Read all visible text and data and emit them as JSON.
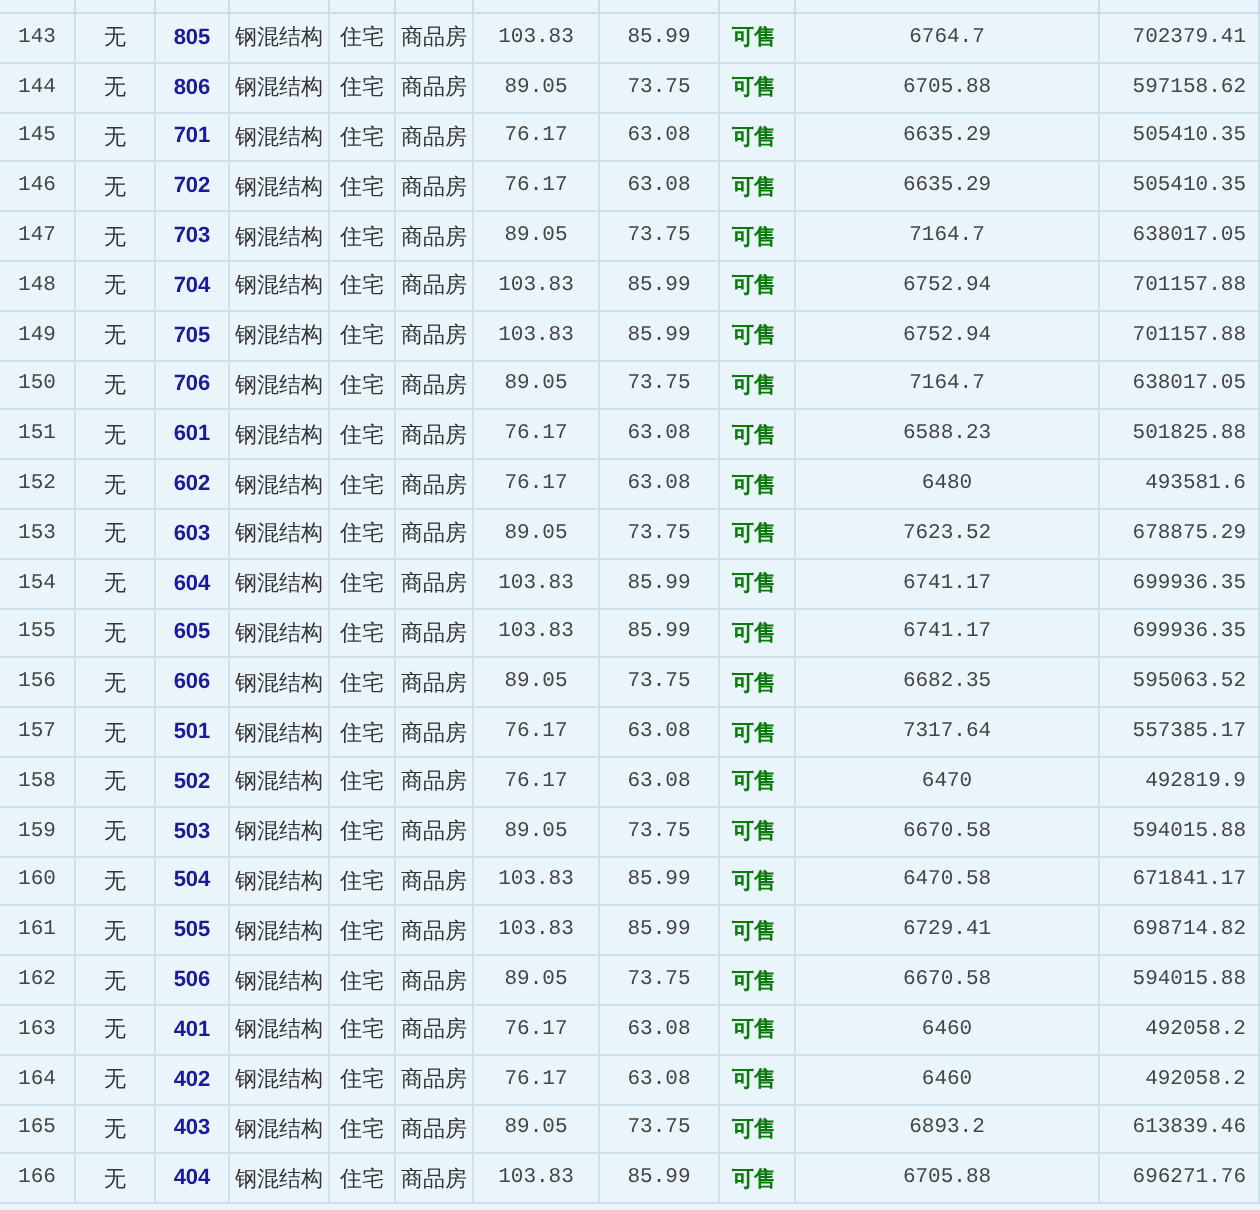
{
  "table": {
    "rows": [
      [
        "143",
        "无",
        "805",
        "钢混结构",
        "住宅",
        "商品房",
        "103.83",
        "85.99",
        "可售",
        "6764.7",
        "702379.41"
      ],
      [
        "144",
        "无",
        "806",
        "钢混结构",
        "住宅",
        "商品房",
        "89.05",
        "73.75",
        "可售",
        "6705.88",
        "597158.62"
      ],
      [
        "145",
        "无",
        "701",
        "钢混结构",
        "住宅",
        "商品房",
        "76.17",
        "63.08",
        "可售",
        "6635.29",
        "505410.35"
      ],
      [
        "146",
        "无",
        "702",
        "钢混结构",
        "住宅",
        "商品房",
        "76.17",
        "63.08",
        "可售",
        "6635.29",
        "505410.35"
      ],
      [
        "147",
        "无",
        "703",
        "钢混结构",
        "住宅",
        "商品房",
        "89.05",
        "73.75",
        "可售",
        "7164.7",
        "638017.05"
      ],
      [
        "148",
        "无",
        "704",
        "钢混结构",
        "住宅",
        "商品房",
        "103.83",
        "85.99",
        "可售",
        "6752.94",
        "701157.88"
      ],
      [
        "149",
        "无",
        "705",
        "钢混结构",
        "住宅",
        "商品房",
        "103.83",
        "85.99",
        "可售",
        "6752.94",
        "701157.88"
      ],
      [
        "150",
        "无",
        "706",
        "钢混结构",
        "住宅",
        "商品房",
        "89.05",
        "73.75",
        "可售",
        "7164.7",
        "638017.05"
      ],
      [
        "151",
        "无",
        "601",
        "钢混结构",
        "住宅",
        "商品房",
        "76.17",
        "63.08",
        "可售",
        "6588.23",
        "501825.88"
      ],
      [
        "152",
        "无",
        "602",
        "钢混结构",
        "住宅",
        "商品房",
        "76.17",
        "63.08",
        "可售",
        "6480",
        "493581.6"
      ],
      [
        "153",
        "无",
        "603",
        "钢混结构",
        "住宅",
        "商品房",
        "89.05",
        "73.75",
        "可售",
        "7623.52",
        "678875.29"
      ],
      [
        "154",
        "无",
        "604",
        "钢混结构",
        "住宅",
        "商品房",
        "103.83",
        "85.99",
        "可售",
        "6741.17",
        "699936.35"
      ],
      [
        "155",
        "无",
        "605",
        "钢混结构",
        "住宅",
        "商品房",
        "103.83",
        "85.99",
        "可售",
        "6741.17",
        "699936.35"
      ],
      [
        "156",
        "无",
        "606",
        "钢混结构",
        "住宅",
        "商品房",
        "89.05",
        "73.75",
        "可售",
        "6682.35",
        "595063.52"
      ],
      [
        "157",
        "无",
        "501",
        "钢混结构",
        "住宅",
        "商品房",
        "76.17",
        "63.08",
        "可售",
        "7317.64",
        "557385.17"
      ],
      [
        "158",
        "无",
        "502",
        "钢混结构",
        "住宅",
        "商品房",
        "76.17",
        "63.08",
        "可售",
        "6470",
        "492819.9"
      ],
      [
        "159",
        "无",
        "503",
        "钢混结构",
        "住宅",
        "商品房",
        "89.05",
        "73.75",
        "可售",
        "6670.58",
        "594015.88"
      ],
      [
        "160",
        "无",
        "504",
        "钢混结构",
        "住宅",
        "商品房",
        "103.83",
        "85.99",
        "可售",
        "6470.58",
        "671841.17"
      ],
      [
        "161",
        "无",
        "505",
        "钢混结构",
        "住宅",
        "商品房",
        "103.83",
        "85.99",
        "可售",
        "6729.41",
        "698714.82"
      ],
      [
        "162",
        "无",
        "506",
        "钢混结构",
        "住宅",
        "商品房",
        "89.05",
        "73.75",
        "可售",
        "6670.58",
        "594015.88"
      ],
      [
        "163",
        "无",
        "401",
        "钢混结构",
        "住宅",
        "商品房",
        "76.17",
        "63.08",
        "可售",
        "6460",
        "492058.2"
      ],
      [
        "164",
        "无",
        "402",
        "钢混结构",
        "住宅",
        "商品房",
        "76.17",
        "63.08",
        "可售",
        "6460",
        "492058.2"
      ],
      [
        "165",
        "无",
        "403",
        "钢混结构",
        "住宅",
        "商品房",
        "89.05",
        "73.75",
        "可售",
        "6893.2",
        "613839.46"
      ],
      [
        "166",
        "无",
        "404",
        "钢混结构",
        "住宅",
        "商品房",
        "103.83",
        "85.99",
        "可售",
        "6705.88",
        "696271.76"
      ]
    ]
  }
}
